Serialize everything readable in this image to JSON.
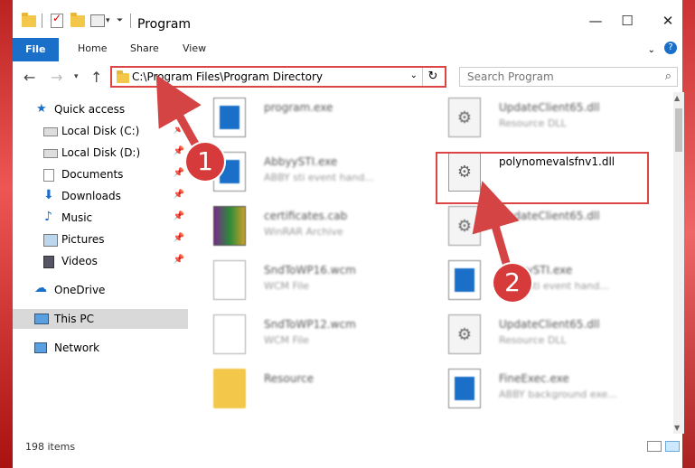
{
  "window": {
    "title": "Program",
    "minimize_glyph": "—",
    "maximize_glyph": "☐",
    "close_glyph": "✕"
  },
  "ribbon": {
    "tabs": [
      "File",
      "Home",
      "Share",
      "View"
    ]
  },
  "nav": {
    "address": "C:\\Program Files\\Program Directory",
    "search_placeholder": "Search Program"
  },
  "sidebar": {
    "items": [
      {
        "label": "Quick access",
        "icon": "star-icon",
        "pinned": false
      },
      {
        "label": "Local Disk (C:)",
        "icon": "drive-icon",
        "pinned": true
      },
      {
        "label": "Local Disk (D:)",
        "icon": "drive-icon",
        "pinned": true
      },
      {
        "label": "Documents",
        "icon": "documents-icon",
        "pinned": true
      },
      {
        "label": "Downloads",
        "icon": "download-icon",
        "pinned": true
      },
      {
        "label": "Music",
        "icon": "music-icon",
        "pinned": true
      },
      {
        "label": "Pictures",
        "icon": "pictures-icon",
        "pinned": true
      },
      {
        "label": "Videos",
        "icon": "videos-icon",
        "pinned": true
      },
      {
        "label": "OneDrive",
        "icon": "cloud-icon",
        "pinned": false
      },
      {
        "label": "This PC",
        "icon": "computer-icon",
        "pinned": false
      },
      {
        "label": "Network",
        "icon": "network-icon",
        "pinned": false
      }
    ]
  },
  "files": [
    {
      "name": "program.exe",
      "type": "",
      "icon": "program-icon"
    },
    {
      "name": "UpdateClient65.dll",
      "type": "Resource DLL",
      "icon": "dll-icon"
    },
    {
      "name": "AbbyySTI.exe",
      "type": "ABBY sti event hand...",
      "icon": "exe-icon"
    },
    {
      "name": "polynomevalsfnv1.dll",
      "type": "",
      "icon": "dll-icon"
    },
    {
      "name": "certificates.cab",
      "type": "WinRAR Archive",
      "icon": "archive-icon"
    },
    {
      "name": "UpdateClient65.dll",
      "type": "",
      "icon": "dll-icon"
    },
    {
      "name": "SndToWP16.wcm",
      "type": "WCM File",
      "icon": "file-icon"
    },
    {
      "name": "AbbyySTI.exe",
      "type": "ABBY sti event hand...",
      "icon": "exe-icon"
    },
    {
      "name": "SndToWP12.wcm",
      "type": "WCM File",
      "icon": "file-icon"
    },
    {
      "name": "UpdateClient65.dll",
      "type": "Resource DLL",
      "icon": "dll-icon"
    },
    {
      "name": "Resource",
      "type": "",
      "icon": "folder-icon"
    },
    {
      "name": "FineExec.exe",
      "type": "ABBY background exe...",
      "icon": "exe-icon"
    }
  ],
  "status": {
    "item_count": "198 items"
  },
  "annotations": {
    "step1": "1",
    "step2": "2"
  },
  "colors": {
    "accent": "#1a6fc9",
    "annotation": "#d44444",
    "selection": "#cde8ff"
  }
}
